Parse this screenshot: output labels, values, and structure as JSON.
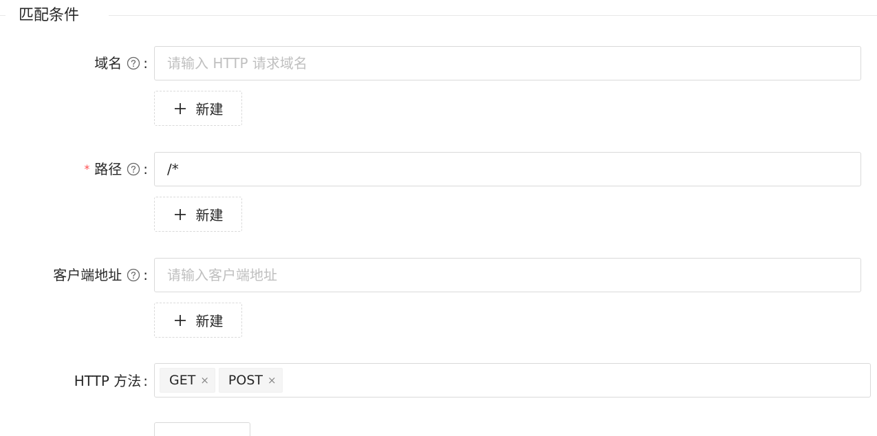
{
  "section": {
    "title": "匹配条件"
  },
  "fields": {
    "domain": {
      "label": "域名",
      "colon": ":",
      "placeholder": "请输入 HTTP 请求域名",
      "value": "",
      "help_icon": "question-circle-icon",
      "add_button_label": "新建",
      "add_icon": "plus-icon"
    },
    "path": {
      "required_mark": "*",
      "label": "路径",
      "colon": ":",
      "value": "/*",
      "help_icon": "question-circle-icon",
      "add_button_label": "新建",
      "add_icon": "plus-icon"
    },
    "client_address": {
      "label": "客户端地址",
      "colon": ":",
      "placeholder": "请输入客户端地址",
      "value": "",
      "help_icon": "question-circle-icon",
      "add_button_label": "新建",
      "add_icon": "plus-icon"
    },
    "http_method": {
      "label": "HTTP 方法",
      "colon": ":",
      "tags": [
        {
          "label": "GET",
          "close": "×"
        },
        {
          "label": "POST",
          "close": "×"
        }
      ]
    }
  },
  "colors": {
    "required": "#ff4d4f",
    "border": "#d9d9d9",
    "placeholder": "#bfbfbf",
    "tag_bg": "#f5f5f5"
  }
}
